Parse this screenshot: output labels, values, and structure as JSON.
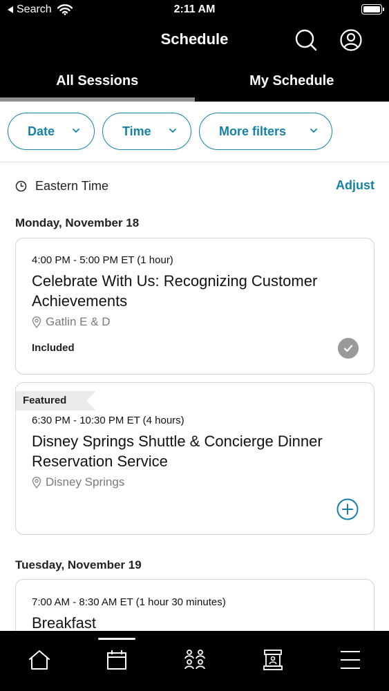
{
  "status_bar": {
    "back_label": "Search",
    "time": "2:11 AM"
  },
  "header": {
    "title": "Schedule"
  },
  "tabs": [
    {
      "label": "All Sessions",
      "active": true
    },
    {
      "label": "My Schedule",
      "active": false
    }
  ],
  "filters": [
    {
      "label": "Date"
    },
    {
      "label": "Time"
    },
    {
      "label": "More filters"
    }
  ],
  "timezone": {
    "label": "Eastern Time",
    "adjust_label": "Adjust"
  },
  "days": [
    {
      "heading": "Monday, November 18",
      "sessions": [
        {
          "time": "4:00 PM - 5:00 PM ET (1 hour)",
          "title": "Celebrate With Us: Recognizing Customer Achievements",
          "location": "Gatlin E & D",
          "status": "Included"
        },
        {
          "tag": "Featured",
          "time": "6:30 PM - 10:30 PM ET (4 hours)",
          "title": "Disney Springs Shuttle & Concierge Dinner Reservation Service",
          "location": "Disney Springs"
        }
      ]
    },
    {
      "heading": "Tuesday, November 19",
      "sessions": [
        {
          "time": "7:00 AM - 8:30 AM ET (1 hour 30 minutes)",
          "title": "Breakfast"
        }
      ]
    }
  ],
  "bottom_nav": [
    {
      "icon": "home-icon"
    },
    {
      "icon": "calendar-icon",
      "active": true
    },
    {
      "icon": "people-icon"
    },
    {
      "icon": "booth-icon"
    },
    {
      "icon": "menu-icon"
    }
  ],
  "colors": {
    "accent": "#1482a6",
    "header_bg": "#000000",
    "tab_indicator": "#8f8f8f",
    "included_check": "#9a9a9a",
    "featured_tag_bg": "#ebebeb"
  }
}
